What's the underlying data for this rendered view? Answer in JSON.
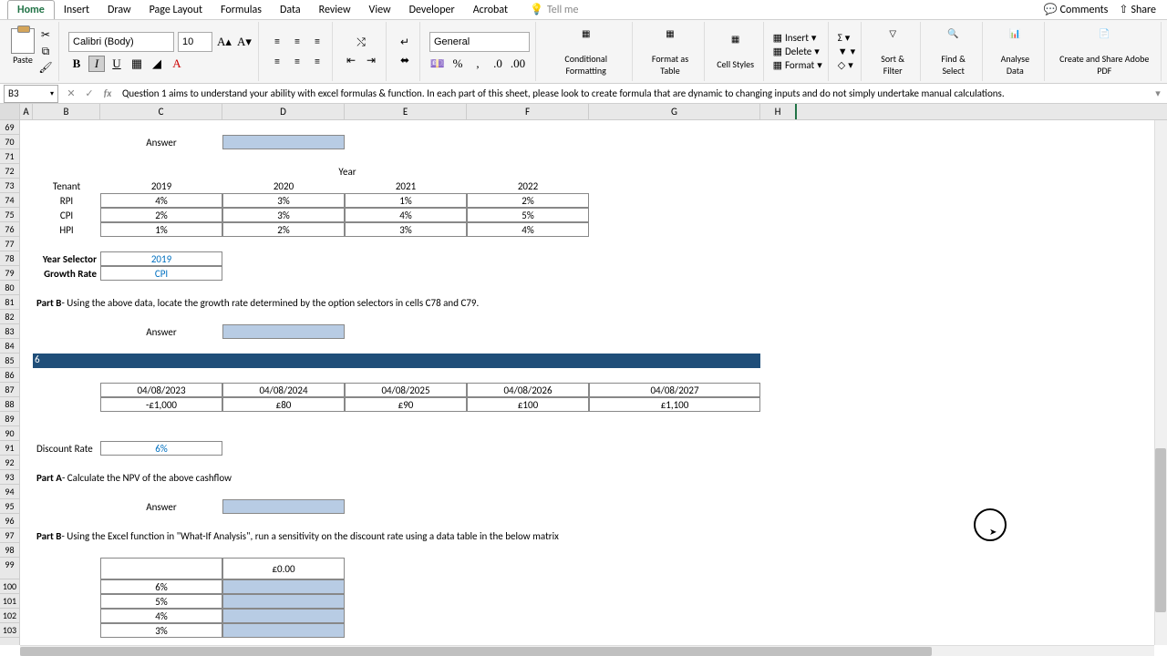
{
  "tabs": [
    "Home",
    "Insert",
    "Draw",
    "Page Layout",
    "Formulas",
    "Data",
    "Review",
    "View",
    "Developer",
    "Acrobat"
  ],
  "tell_me": "Tell me",
  "comments": "Comments",
  "share": "Share",
  "paste": "Paste",
  "font_name": "Calibri (Body)",
  "font_size": "10",
  "number_format": "General",
  "cond_fmt": "Conditional Formatting",
  "fmt_table": "Format as Table",
  "cell_styles": "Cell Styles",
  "insert": "Insert",
  "delete": "Delete",
  "format": "Format",
  "sort_filter": "Sort & Filter",
  "find_select": "Find & Select",
  "analyse": "Analyse Data",
  "adobe": "Create and Share Adobe PDF",
  "name_box": "B3",
  "formula": "Question 1 aims to understand your ability with excel formulas & function. In each part of this sheet, please look to create formula that are dynamic to changing inputs and do not simply undertake manual calculations.",
  "cols": [
    "A",
    "B",
    "C",
    "D",
    "E",
    "F",
    "G",
    "H"
  ],
  "rows": [
    "69",
    "70",
    "71",
    "72",
    "73",
    "74",
    "75",
    "76",
    "77",
    "78",
    "79",
    "80",
    "81",
    "82",
    "83",
    "84",
    "85",
    "86",
    "87",
    "88",
    "89",
    "90",
    "91",
    "92",
    "93",
    "94",
    "95",
    "96",
    "97",
    "98",
    "99",
    "100",
    "101",
    "102",
    "103"
  ],
  "labels": {
    "answer": "Answer",
    "year": "Year",
    "tenant": "Tenant",
    "year_selector": "Year Selector",
    "growth_rate": "Growth Rate",
    "discount_rate": "Discount Rate"
  },
  "index_table": {
    "years": [
      "2019",
      "2020",
      "2021",
      "2022"
    ],
    "rows": [
      {
        "name": "RPI",
        "vals": [
          "4%",
          "3%",
          "1%",
          "2%"
        ]
      },
      {
        "name": "CPI",
        "vals": [
          "2%",
          "3%",
          "4%",
          "5%"
        ]
      },
      {
        "name": "HPI",
        "vals": [
          "1%",
          "2%",
          "3%",
          "4%"
        ]
      }
    ]
  },
  "selectors": {
    "year": "2019",
    "rate": "CPI"
  },
  "partB_text": {
    "b": "Part B",
    "rest": " - Using the above data, locate the growth rate determined by the option selectors in cells C78 and C79."
  },
  "section6": "6",
  "cashflow": {
    "dates": [
      "04/08/2023",
      "04/08/2024",
      "04/08/2025",
      "04/08/2026",
      "04/08/2027"
    ],
    "vals": [
      "-£1,000",
      "£80",
      "£90",
      "£100",
      "£1,100"
    ]
  },
  "discount_rate_val": "6%",
  "partA6": {
    "b": "Part A",
    "rest": " - Calculate the NPV of the above cashflow"
  },
  "partB6": {
    "b": "Part B",
    "rest": " - Using the Excel function in \"What-If Analysis\", run a sensitivity on the discount rate using a data table in the below matrix"
  },
  "datatable": {
    "header": "£0.00",
    "rates": [
      "6%",
      "5%",
      "4%",
      "3%"
    ]
  },
  "chart_data": null
}
